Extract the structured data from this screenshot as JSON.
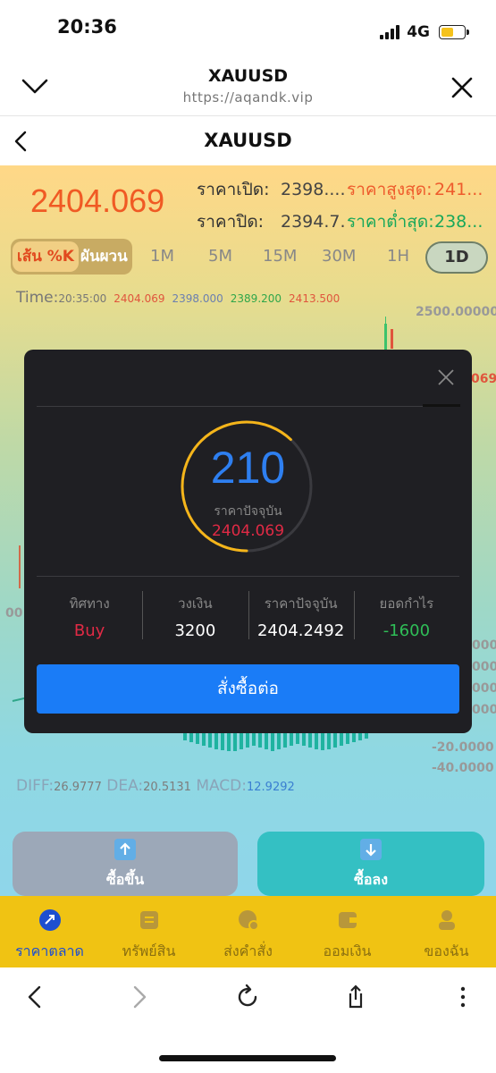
{
  "status": {
    "time": "20:36",
    "network": "4G"
  },
  "browser": {
    "title": "XAUUSD",
    "url": "https://aqandk.vip",
    "nav": [
      "back",
      "forward",
      "reload",
      "share",
      "more"
    ]
  },
  "app": {
    "title": "XAUUSD"
  },
  "quote": {
    "price": "2404.069",
    "open_label": "ราคาเปิด:",
    "open_value": "2398....",
    "high_label": "ราคาสูงสุด:",
    "high_value": "241...",
    "close_label": "ราคาปิด:",
    "close_value": "2394.7...",
    "low_label": "ราคาต่ำสุด:",
    "low_value": "238..."
  },
  "chart_toolbar": {
    "line_k": "เส้น %K",
    "candle": "ผันผวน",
    "timeframes": [
      "1M",
      "5M",
      "15M",
      "30M",
      "1H"
    ],
    "selected": "1D"
  },
  "time_row": {
    "label": "Time:",
    "time": "20:35:00",
    "v1": "2404.069",
    "v2": "2398.000",
    "v3": "2389.200",
    "v4": "2413.500"
  },
  "axis": {
    "top": "2500.00000",
    "price_tag": "069",
    "left_time": "00:",
    "m1": "0000",
    "m2": "0000",
    "m3": "0000",
    "m4": "0000",
    "m5": "-20.0000",
    "m6": "-40.0000"
  },
  "macd": {
    "diff_label": "DIFF:",
    "diff_value": "26.9777",
    "dea_label": "DEA:",
    "dea_value": "20.5131",
    "macd_label": "MACD:",
    "macd_value": "12.9292"
  },
  "trade": {
    "buy_up": "ซื้อขึ้น",
    "buy_down": "ซื้อลง"
  },
  "tabs": [
    {
      "label": "ราคาตลาด",
      "icon": "market-icon"
    },
    {
      "label": "ทรัพย์สิน",
      "icon": "assets-icon"
    },
    {
      "label": "ส่งคำสั่ง",
      "icon": "orders-icon"
    },
    {
      "label": "ออมเงิน",
      "icon": "savings-icon"
    },
    {
      "label": "ของฉัน",
      "icon": "profile-icon"
    }
  ],
  "modal": {
    "countdown": "210",
    "countdown_progress": 0.62,
    "current_label": "ราคาปัจจุบัน",
    "current_value": "2404.069",
    "direction_label": "ทิศทาง",
    "direction_value": "Buy",
    "amount_label": "วงเงิน",
    "amount_value": "3200",
    "price_label": "ราคาปัจจุบัน",
    "price_value": "2404.2492",
    "profit_label": "ยอดกำไร",
    "profit_value": "-1600",
    "continue_button": "สั่งซื้อต่อ"
  },
  "colors": {
    "accent_blue": "#1a7cf7",
    "up_red": "#e02a45",
    "down_green": "#2fbe57",
    "tabbar_yellow": "#f0c313"
  }
}
